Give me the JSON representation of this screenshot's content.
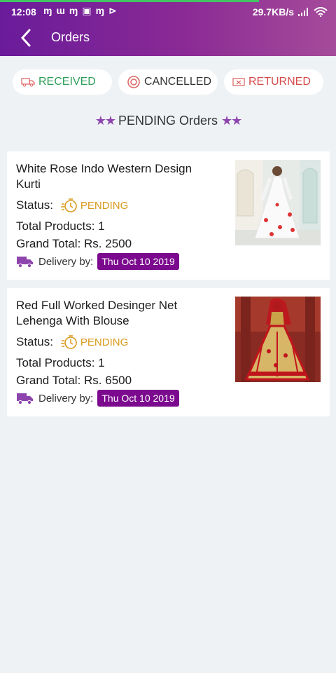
{
  "status_bar": {
    "time": "12:08",
    "net_speed": "29.7KB/s",
    "notif_icons": [
      "app-m-icon",
      "app-w-icon",
      "app-m-icon",
      "gallery-icon",
      "app-m-icon",
      "play-icon"
    ]
  },
  "toolbar": {
    "title": "Orders"
  },
  "filters": [
    {
      "label": "RECEIVED",
      "color": "#2e9e5a",
      "icon": "truck-outline-icon"
    },
    {
      "label": "CANCELLED",
      "color": "#333333",
      "icon": "cancel-circle-icon"
    },
    {
      "label": "RETURNED",
      "color": "#d64a4a",
      "icon": "return-box-icon"
    }
  ],
  "section": {
    "title": "PENDING Orders"
  },
  "orders": [
    {
      "name": "White Rose Indo Western Design Kurti",
      "status_label": "Status:",
      "status": "PENDING",
      "total_products": "Total Products: 1",
      "grand_total": "Grand Total: Rs. 2500",
      "delivery_label": "Delivery by:",
      "delivery_date": "Thu Oct 10 2019"
    },
    {
      "name": "Red Full Worked Desinger Net Lehenga With Blouse",
      "status_label": "Status:",
      "status": "PENDING",
      "total_products": "Total Products: 1",
      "grand_total": "Grand Total: Rs. 6500",
      "delivery_label": "Delivery by:",
      "delivery_date": "Thu Oct 10 2019"
    }
  ],
  "colors": {
    "brand": "#7b0a8e",
    "pending": "#d99a1c",
    "background": "#eef2f5"
  }
}
